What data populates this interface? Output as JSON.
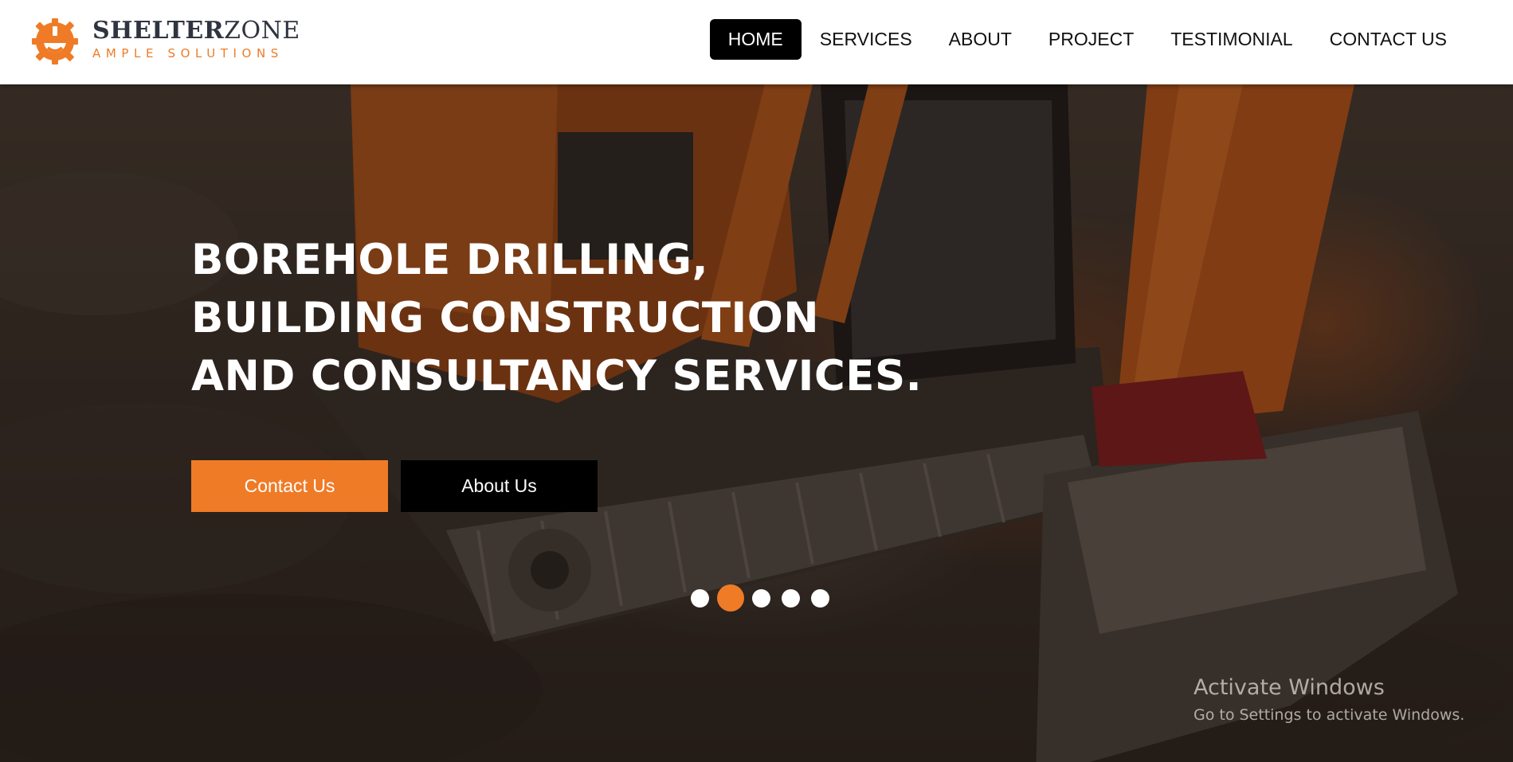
{
  "brand": {
    "title_bold": "SHELTER",
    "title_thin": "ZONE",
    "subtitle": "AMPLE SOLUTIONS",
    "logo_icon": "hardhat-gear-icon",
    "accent_color": "#ef7b27"
  },
  "nav": {
    "items": [
      {
        "label": "HOME",
        "active": true
      },
      {
        "label": "SERVICES",
        "active": false
      },
      {
        "label": "ABOUT",
        "active": false
      },
      {
        "label": "PROJECT",
        "active": false
      },
      {
        "label": "TESTIMONIAL",
        "active": false
      },
      {
        "label": "CONTACT US",
        "active": false
      }
    ]
  },
  "hero": {
    "headline": [
      "BOREHOLE DRILLING,",
      "BUILDING CONSTRUCTION",
      "AND CONSULTANCY SERVICES."
    ],
    "primary_button": "Contact Us",
    "secondary_button": "About Us",
    "carousel": {
      "total_slides": 5,
      "active_slide": 2
    }
  },
  "os_watermark": {
    "title": "Activate Windows",
    "subtitle": "Go to Settings to activate Windows."
  }
}
